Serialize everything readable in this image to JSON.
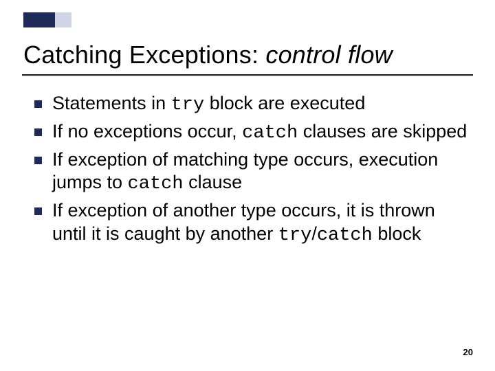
{
  "title": {
    "main": "Catching Exceptions: ",
    "italic": "control flow"
  },
  "bullets": [
    {
      "pre": "Statements in ",
      "code1": "try",
      "mid": " block are executed",
      "code2": "",
      "post": ""
    },
    {
      "pre": "If no exceptions occur, ",
      "code1": "catch",
      "mid": " clauses are skipped",
      "code2": "",
      "post": ""
    },
    {
      "pre": "If exception of matching type occurs, execution  jumps to ",
      "code1": "catch",
      "mid": " clause",
      "code2": "",
      "post": ""
    },
    {
      "pre": "If exception of another type occurs, it is thrown until it is caught by another ",
      "code1": "try",
      "mid": "/",
      "code2": "catch",
      "post": " block"
    }
  ],
  "page_number": "20"
}
